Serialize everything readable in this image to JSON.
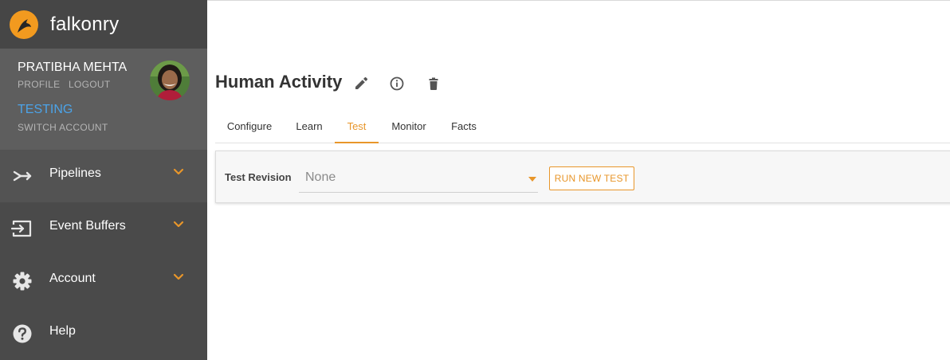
{
  "brand": {
    "name": "falkonry",
    "logo_icon": "falkonry-logo-icon",
    "logo_color": "#f29a1f"
  },
  "user": {
    "name": "PRATIBHA MEHTA",
    "profile_label": "PROFILE",
    "logout_label": "LOGOUT",
    "environment": "TESTING",
    "switch_label": "SWITCH ACCOUNT"
  },
  "sidebar": {
    "items": [
      {
        "label": "Pipelines",
        "icon": "pipeline-merge-icon",
        "expandable": true
      },
      {
        "label": "Event Buffers",
        "icon": "input-icon",
        "expandable": true
      },
      {
        "label": "Account",
        "icon": "gear-icon",
        "expandable": true
      },
      {
        "label": "Help",
        "icon": "help-circle-icon",
        "expandable": false
      }
    ]
  },
  "main": {
    "title": "Human Activity",
    "actions": [
      "edit-icon",
      "info-icon",
      "trash-icon"
    ],
    "tabs": [
      {
        "label": "Configure",
        "active": false
      },
      {
        "label": "Learn",
        "active": false
      },
      {
        "label": "Test",
        "active": true
      },
      {
        "label": "Monitor",
        "active": false
      },
      {
        "label": "Facts",
        "active": false
      }
    ],
    "test": {
      "label": "Test Revision",
      "selected": "None",
      "run_button": "RUN NEW TEST"
    }
  },
  "colors": {
    "accent": "#e8962a",
    "environment": "#4ba3e8",
    "sidebar": "#4a4a4a"
  }
}
